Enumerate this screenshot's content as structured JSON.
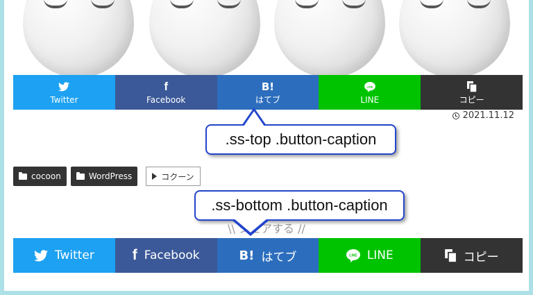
{
  "share_top": {
    "buttons": [
      {
        "id": "twitter",
        "icon": "twitter-bird-icon",
        "glyph": "🐦",
        "caption": "Twitter",
        "color": "#1da1f2"
      },
      {
        "id": "facebook",
        "icon": "facebook-f-icon",
        "glyph": "f",
        "caption": "Facebook",
        "color": "#3b5998"
      },
      {
        "id": "hatena",
        "icon": "hatena-bookmark-icon",
        "glyph": "B!",
        "caption": "はてブ",
        "color": "#2c6ebd"
      },
      {
        "id": "line",
        "icon": "line-icon",
        "glyph": "●",
        "caption": "LINE",
        "color": "#00c300"
      },
      {
        "id": "copy",
        "icon": "copy-icon",
        "glyph": "❐",
        "caption": "コピー",
        "color": "#333333"
      }
    ]
  },
  "date": {
    "icon": "clock-icon",
    "text": "2021.11.12"
  },
  "callouts": {
    "top": ".ss-top .button-caption",
    "bottom": ".ss-bottom .button-caption"
  },
  "categories": [
    "cocoon",
    "WordPress"
  ],
  "tags": [
    "コクーン"
  ],
  "share_message": "\\\\ シェアする //",
  "share_bottom": {
    "buttons": [
      {
        "id": "twitter",
        "glyph": "🐦",
        "caption": "Twitter"
      },
      {
        "id": "facebook",
        "glyph": "f",
        "caption": "Facebook"
      },
      {
        "id": "hatena",
        "glyph": "B!",
        "caption": "はてブ"
      },
      {
        "id": "line",
        "glyph": "●",
        "caption": "LINE"
      },
      {
        "id": "copy",
        "glyph": "❐",
        "caption": "コピー"
      }
    ]
  }
}
